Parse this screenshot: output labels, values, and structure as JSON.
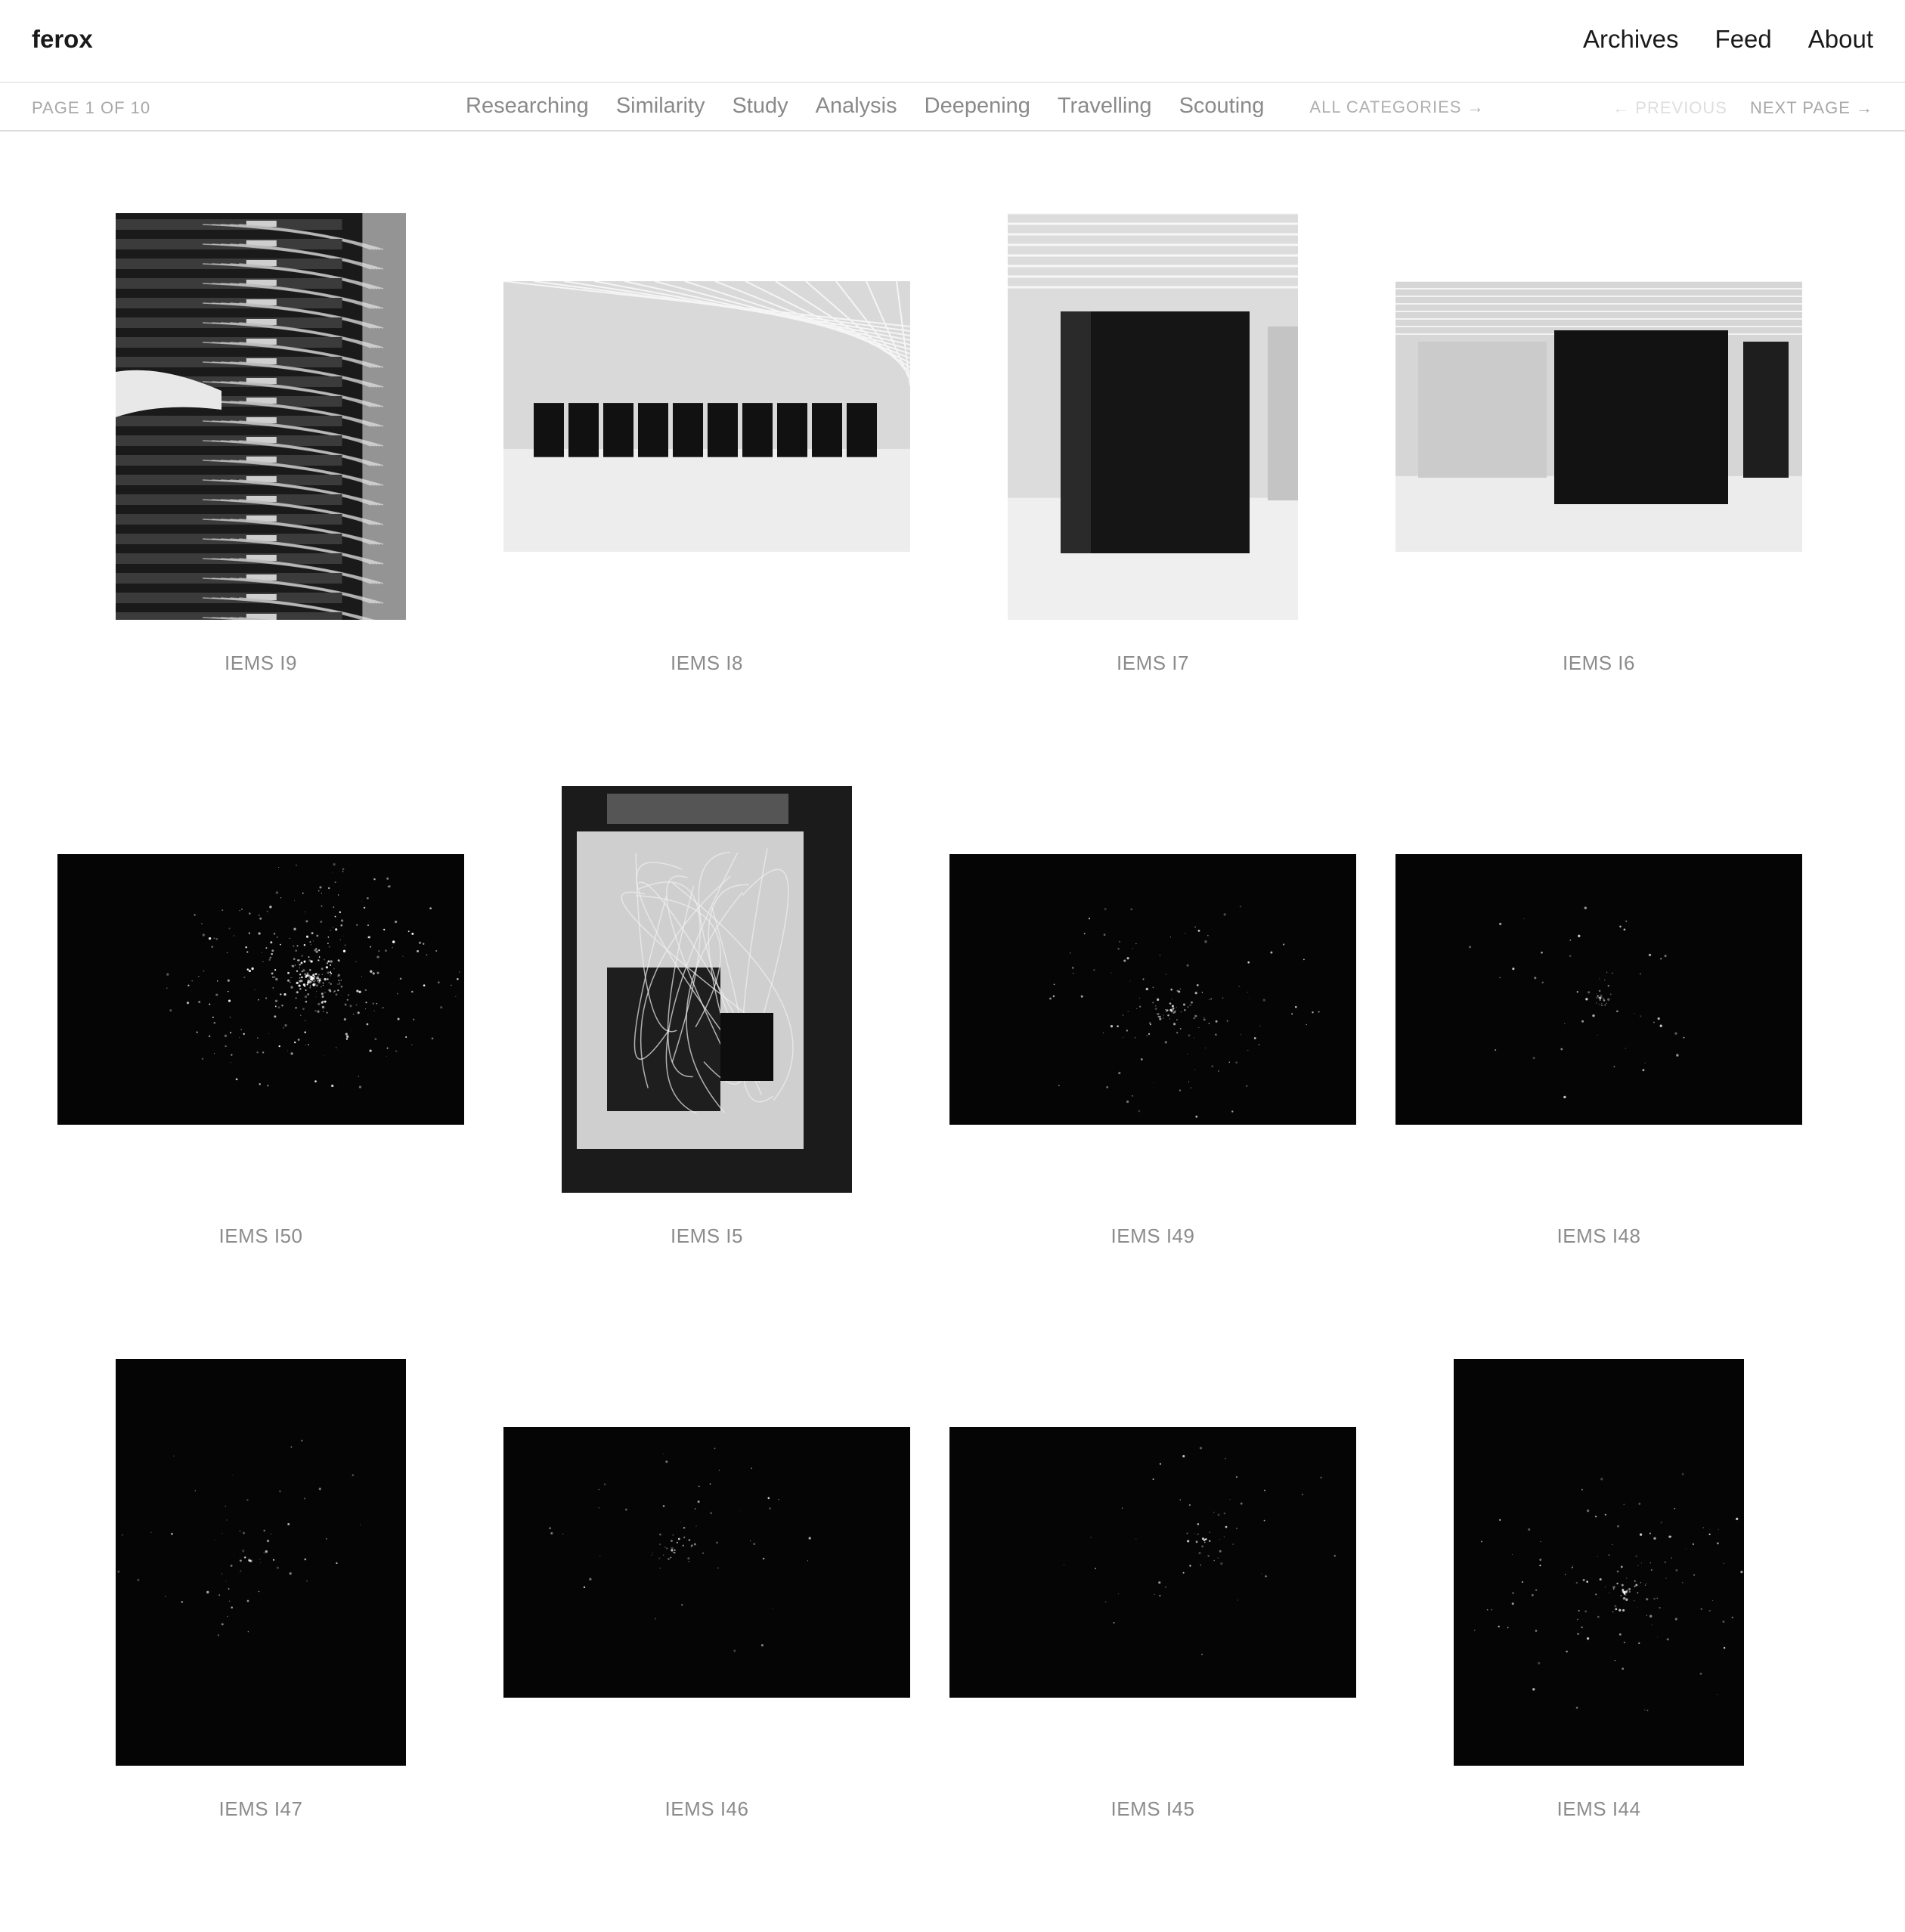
{
  "site": {
    "logo": "ferox"
  },
  "topnav": {
    "archives": "Archives",
    "feed": "Feed",
    "about": "About"
  },
  "subbar": {
    "page_info": "PAGE 1 OF 10",
    "categories": [
      "Researching",
      "Similarity",
      "Study",
      "Analysis",
      "Deepening",
      "Travelling",
      "Scouting"
    ],
    "all_categories": "ALL CATEGORIES →",
    "previous": "← PREVIOUS",
    "next": "NEXT PAGE →"
  },
  "gallery": {
    "items": [
      {
        "caption": "IEMS I9",
        "orientation": "portrait",
        "tone": "cables"
      },
      {
        "caption": "IEMS I8",
        "orientation": "landscape",
        "tone": "hall"
      },
      {
        "caption": "IEMS I7",
        "orientation": "portrait",
        "tone": "cabinet"
      },
      {
        "caption": "IEMS I6",
        "orientation": "landscape",
        "tone": "racks"
      },
      {
        "caption": "IEMS I50",
        "orientation": "landscape",
        "tone": "stars-bright"
      },
      {
        "caption": "IEMS I5",
        "orientation": "portrait",
        "tone": "panel"
      },
      {
        "caption": "IEMS I49",
        "orientation": "landscape",
        "tone": "stars"
      },
      {
        "caption": "IEMS I48",
        "orientation": "landscape",
        "tone": "stars-faint"
      },
      {
        "caption": "IEMS I47",
        "orientation": "portrait",
        "tone": "stars-faint"
      },
      {
        "caption": "IEMS I46",
        "orientation": "landscape",
        "tone": "stars-faint"
      },
      {
        "caption": "IEMS I45",
        "orientation": "landscape",
        "tone": "stars-faint"
      },
      {
        "caption": "IEMS I44",
        "orientation": "portrait",
        "tone": "stars"
      }
    ]
  }
}
